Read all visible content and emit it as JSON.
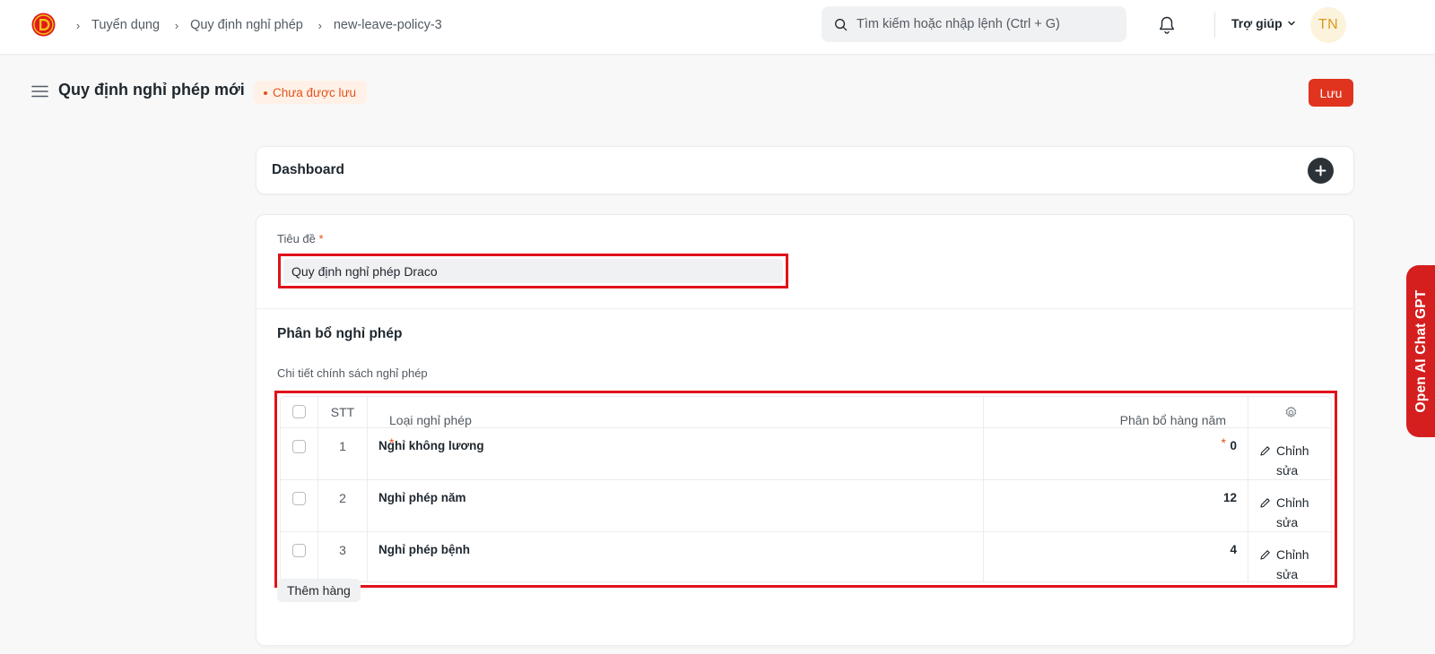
{
  "navbar": {
    "breadcrumbs": [
      "Tuyển dụng",
      "Quy định nghỉ phép",
      "new-leave-policy-3"
    ],
    "search_placeholder": "Tìm kiếm hoặc nhập lệnh (Ctrl + G)",
    "help_label": "Trợ giúp",
    "avatar_initials": "TN"
  },
  "page": {
    "title": "Quy định nghỉ phép mới",
    "status": "Chưa được lưu",
    "save_label": "Lưu"
  },
  "dashboard": {
    "title": "Dashboard"
  },
  "form": {
    "title_label": "Tiêu đề",
    "required_mark": "*",
    "title_value": "Quy định nghỉ phép Draco",
    "section_title": "Phân bổ nghỉ phép",
    "table_label": "Chi tiết chính sách nghỉ phép",
    "table": {
      "headers": {
        "index": "STT",
        "leave_type": "Loại nghỉ phép",
        "annual_allocation": "Phân bổ hàng năm"
      },
      "rows": [
        {
          "index": "1",
          "leave_type": "Nghỉ không lương",
          "annual_allocation": "0",
          "edit_label": "Chỉnh sửa"
        },
        {
          "index": "2",
          "leave_type": "Nghỉ phép năm",
          "annual_allocation": "12",
          "edit_label": "Chỉnh sửa"
        },
        {
          "index": "3",
          "leave_type": "Nghỉ phép bệnh",
          "annual_allocation": "4",
          "edit_label": "Chỉnh sửa"
        }
      ]
    },
    "add_row_label": "Thêm hàng"
  },
  "side_tab": {
    "label": "Open AI Chat GPT"
  },
  "colors": {
    "accent_red": "#e0341f",
    "highlight_red": "#e0121a",
    "unsaved_text": "#e2521b",
    "side_tab": "#d51f1f"
  }
}
